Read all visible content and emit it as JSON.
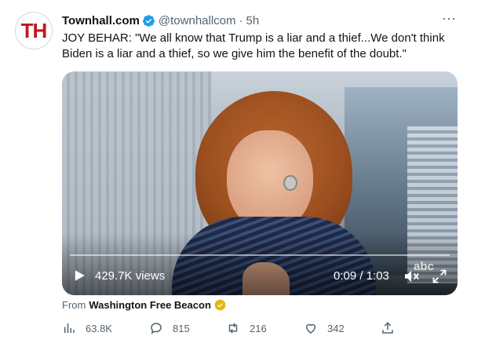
{
  "tweet": {
    "avatar_text": "TH",
    "author_name": "Townhall.com",
    "handle": "@townhallcom",
    "separator": "·",
    "time": "5h",
    "more_label": "···",
    "text": "JOY BEHAR: \"We all know that Trump is a liar and a thief...We don't think Biden is a liar and a thief, so we give him the benefit of the doubt.\""
  },
  "video": {
    "views": "429.7K views",
    "timecode": "0:09 / 1:03",
    "progress_fraction": 0.0,
    "watermark": "abc"
  },
  "source": {
    "prefix": "From",
    "name": "Washington Free Beacon"
  },
  "actions": {
    "views_count": "63.8K",
    "replies_count": "815",
    "retweets_count": "216",
    "likes_count": "342"
  },
  "colors": {
    "verified_blue": "#1d9bf0",
    "gold_badge": "#e2b719",
    "brand_red": "#c4161c"
  }
}
